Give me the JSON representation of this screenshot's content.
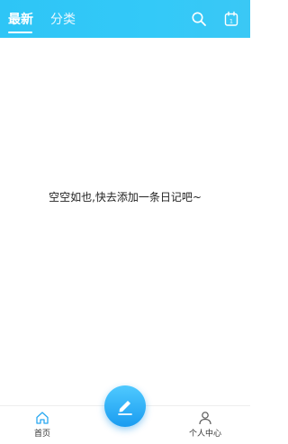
{
  "header": {
    "tabs": [
      {
        "label": "最新",
        "active": true
      },
      {
        "label": "分类",
        "active": false
      }
    ],
    "icons": [
      "search-icon",
      "calendar-icon"
    ],
    "calendar_day": "1",
    "background_color": "#33c9f8"
  },
  "content": {
    "empty_message": "空空如也,快去添加一条日记吧~"
  },
  "fab": {
    "icon": "edit-icon",
    "color": "#2aa8f4"
  },
  "bottom_nav": {
    "items": [
      {
        "label": "首页",
        "icon": "home-icon",
        "active": true
      },
      {
        "label": "个人中心",
        "icon": "person-icon",
        "active": false
      }
    ],
    "active_color": "#29a8f0"
  }
}
